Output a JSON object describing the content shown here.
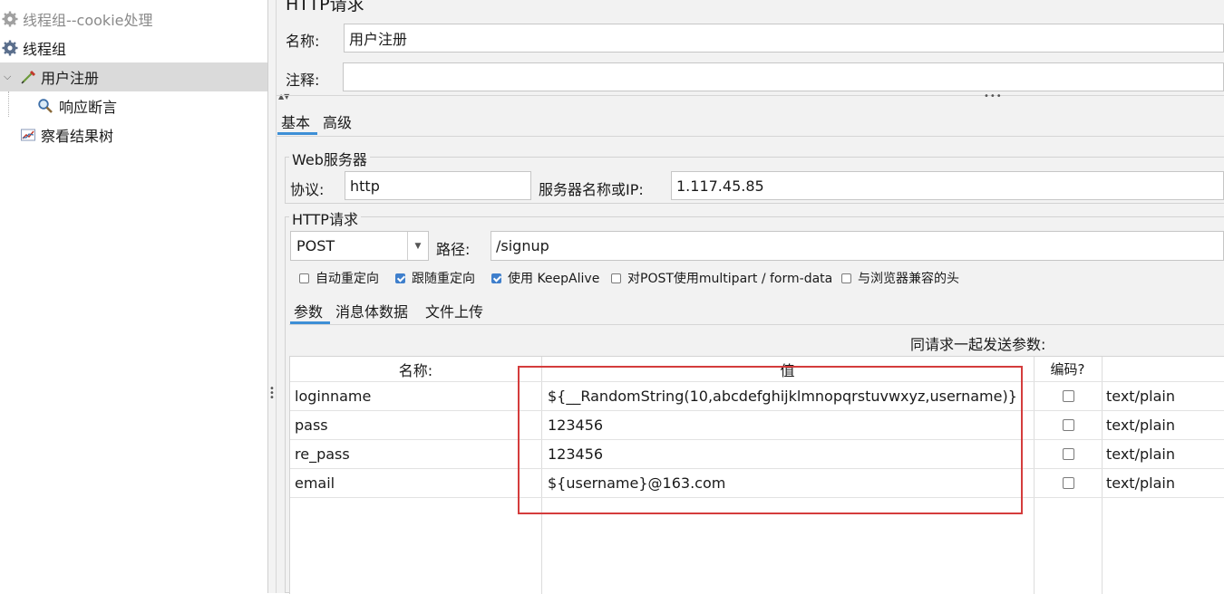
{
  "tree": {
    "items": [
      {
        "label": "线程组--cookie处理",
        "icon": "gear-icon"
      },
      {
        "label": "线程组",
        "icon": "gear-icon"
      },
      {
        "label": "用户注册",
        "icon": "pipette-icon"
      },
      {
        "label": "响应断言",
        "icon": "magnifier-icon"
      },
      {
        "label": "察看结果树",
        "icon": "chart-icon"
      }
    ]
  },
  "sampler": {
    "title": "HTTP请求",
    "name_label": "名称:",
    "name_value": "用户注册",
    "comment_label": "注释:",
    "comment_value": "",
    "tabs": [
      "基本",
      "高级"
    ],
    "web_server": {
      "legend": "Web服务器",
      "protocol_label": "协议:",
      "protocol_value": "http",
      "server_label": "服务器名称或IP:",
      "server_value": "1.117.45.85"
    },
    "http_request": {
      "legend": "HTTP请求",
      "method": "POST",
      "path_label": "路径:",
      "path_value": "/signup",
      "options": [
        {
          "label": "自动重定向",
          "checked": false
        },
        {
          "label": "跟随重定向",
          "checked": true
        },
        {
          "label": "使用 KeepAlive",
          "checked": true
        },
        {
          "label": "对POST使用multipart / form-data",
          "checked": false
        },
        {
          "label": "与浏览器兼容的头",
          "checked": false
        }
      ]
    },
    "param_tabs": [
      "参数",
      "消息体数据",
      "文件上传"
    ],
    "send_params_label": "同请求一起发送参数:",
    "table": {
      "headers": [
        "名称:",
        "值",
        "编码?",
        ""
      ],
      "rows": [
        {
          "name": "loginname",
          "value": "${__RandomString(10,abcdefghijklmnopqrstuvwxyz,username)}",
          "encode": false,
          "content_type": "text/plain"
        },
        {
          "name": "pass",
          "value": "123456",
          "encode": false,
          "content_type": "text/plain"
        },
        {
          "name": "re_pass",
          "value": "123456",
          "encode": false,
          "content_type": "text/plain"
        },
        {
          "name": "email",
          "value": "${username}@163.com",
          "encode": false,
          "content_type": "text/plain"
        }
      ]
    }
  },
  "colors": {
    "accent": "#3d8fd6",
    "highlight_box": "#d43c3c",
    "selected_row": "#dadada"
  }
}
